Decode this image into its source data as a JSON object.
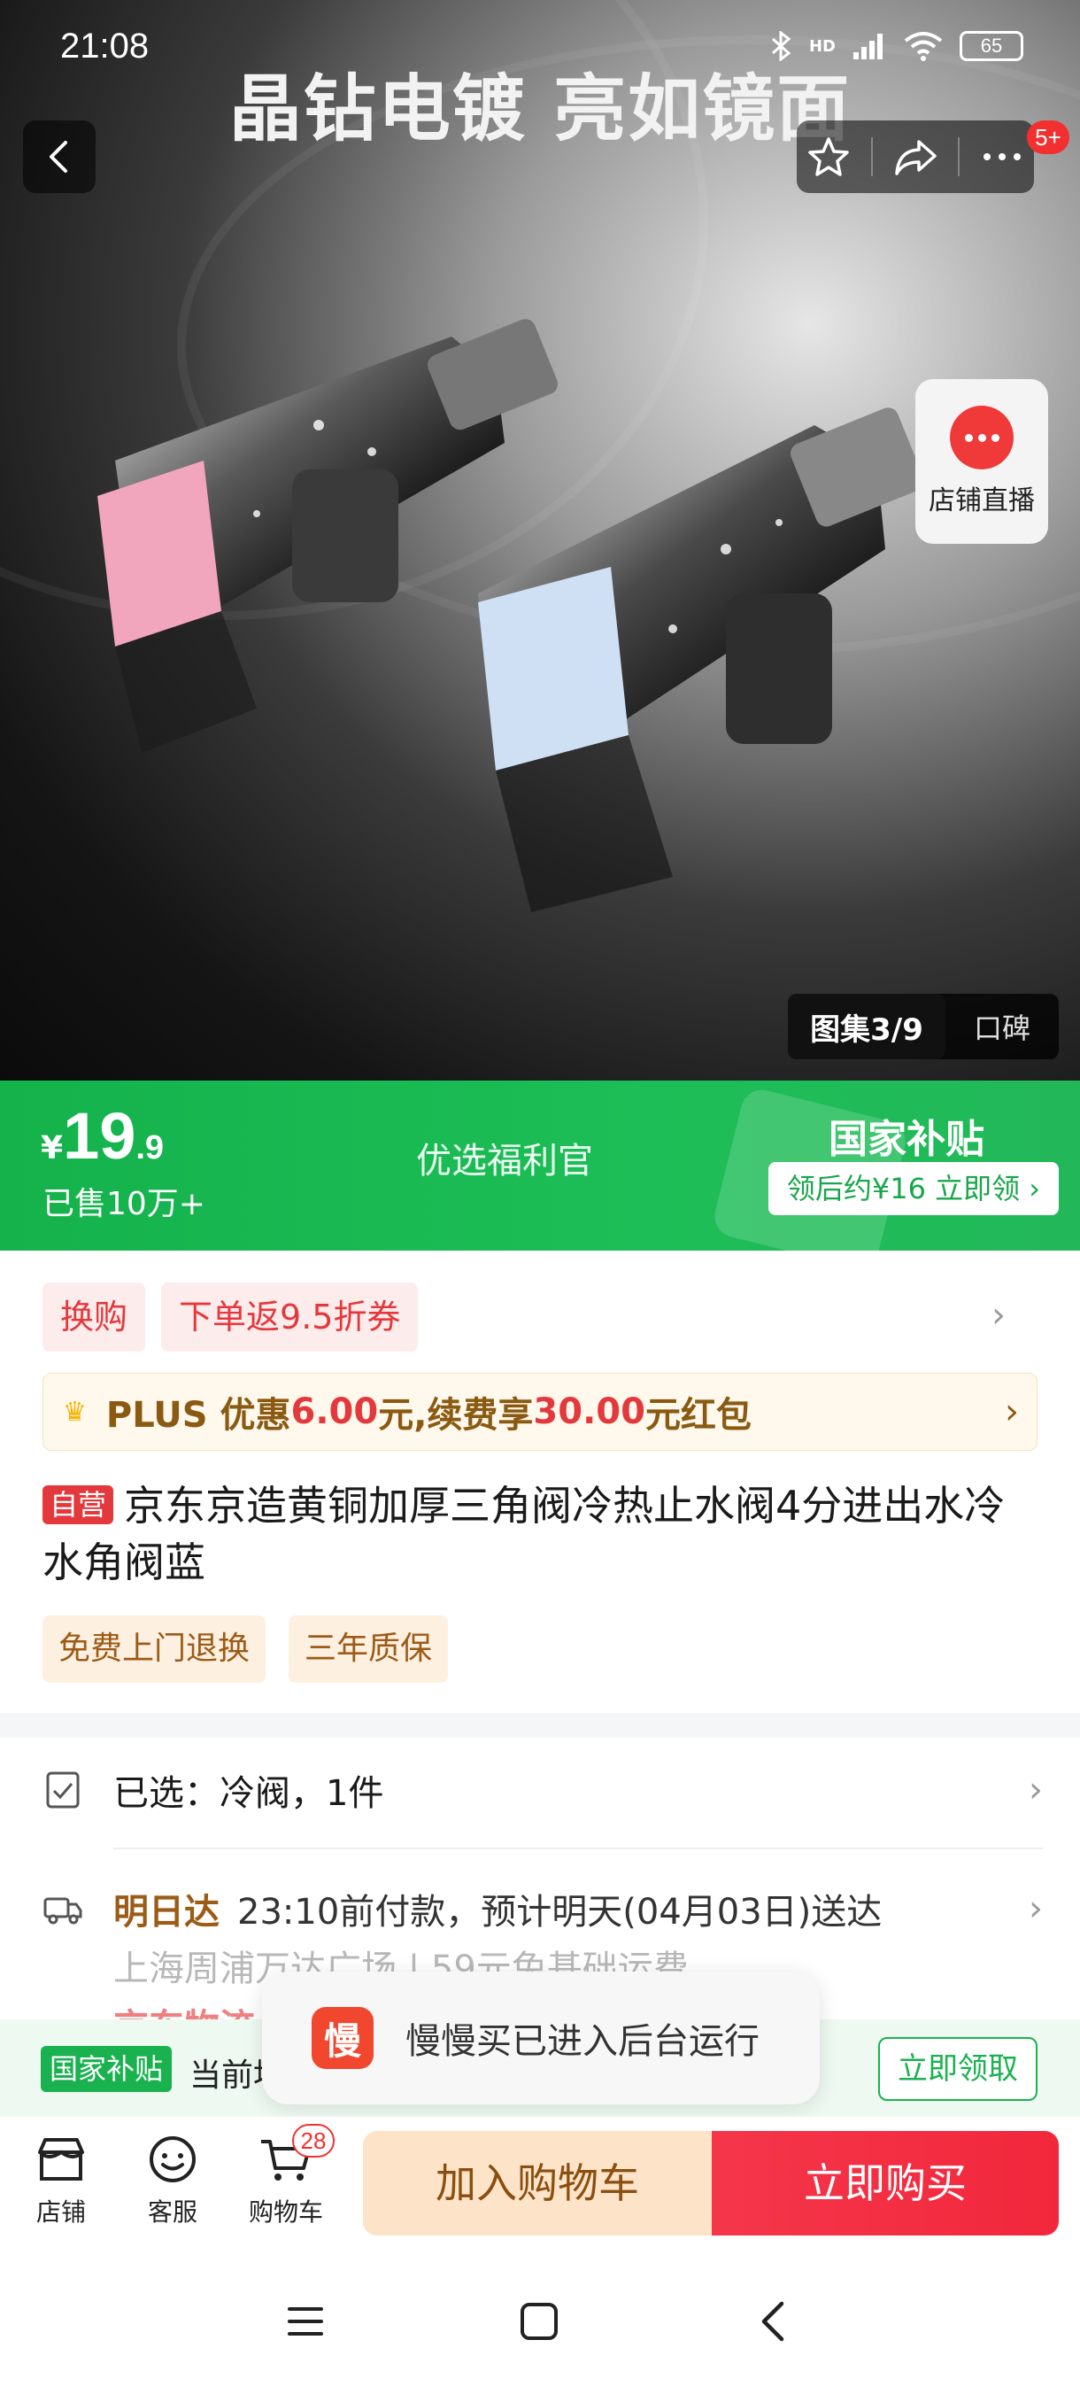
{
  "status_bar": {
    "time": "21:08",
    "network": "HD",
    "battery": "65"
  },
  "hero": {
    "title": "晶钻电镀 亮如镜面",
    "message_badge": "5+",
    "live_label": "店铺直播",
    "gallery_current": "图集3/9",
    "gallery_other": "口碑"
  },
  "price_band": {
    "currency": "¥",
    "price_int": "19",
    "price_dec": ".9",
    "sold": "已售10万+",
    "center_tag": "优选福利官",
    "subsidy_title": "国家补贴",
    "subsidy_button": "领后约¥16 立即领 ›"
  },
  "promo": {
    "tags": [
      "换购",
      "下单返9.5折券"
    ],
    "plus": {
      "p1": "PLUS 优惠",
      "v1": "6.00",
      "p2": "元,续费享",
      "v2": "30.00",
      "p3": "元红包"
    }
  },
  "product": {
    "self_tag": "自营",
    "title": "京东京造黄铜加厚三角阀冷热止水阀4分进出水冷水角阀蓝",
    "services": [
      "免费上门退换",
      "三年质保"
    ]
  },
  "options": {
    "selected": "已选：冷阀，1件",
    "delivery_badge": "明日达",
    "delivery_text": "23:10前付款，预计明天(04月03日)送达",
    "address": "上海周浦万达广场 | 59元免基础运费",
    "logistics": "京东物流"
  },
  "subsidy_bar": {
    "badge": "国家补贴",
    "text": "当前地",
    "claim": "立即领取"
  },
  "toast": {
    "app_icon": "慢",
    "text": "慢慢买已进入后台运行"
  },
  "bottom_bar": {
    "shop": "店铺",
    "service": "客服",
    "cart": "购物车",
    "cart_count": "28",
    "add_to_cart": "加入购物车",
    "buy_now": "立即购买"
  },
  "colors": {
    "brand_red": "#e4393c",
    "subsidy_green": "#19b24f",
    "plus_brown": "#8a5a12"
  }
}
